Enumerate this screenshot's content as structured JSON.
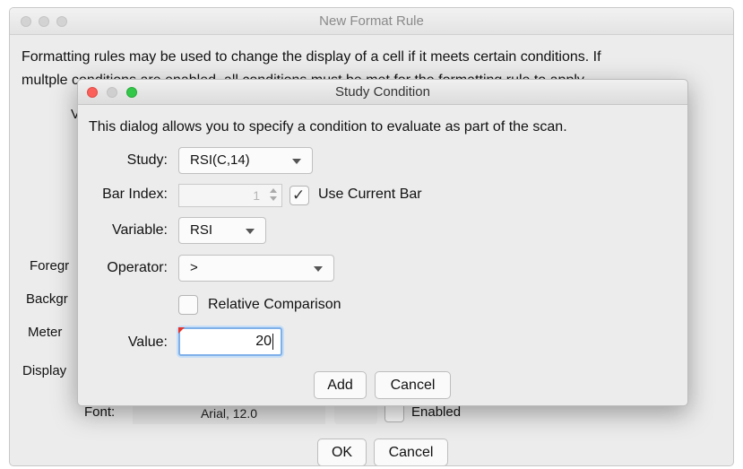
{
  "outer_window": {
    "title": "New Format Rule",
    "description_line1": "Formatting rules may be used to change the display of a cell if it meets certain conditions.  If",
    "description_line2": "multple conditions are enabled, all conditions must be met for the formatting rule to apply.",
    "clipped_labels": [
      "V",
      "Foregr",
      "Backgr",
      "Meter",
      "Display"
    ],
    "font_label": "Font:",
    "font_value": "Arial, 12.0",
    "enabled_label": "Enabled",
    "ok_label": "OK",
    "cancel_label": "Cancel"
  },
  "dialog": {
    "title": "Study Condition",
    "description": "This dialog allows you to specify a condition to evaluate as part of the scan.",
    "study_label": "Study:",
    "study_value": "RSI(C,14)",
    "bar_index_label": "Bar Index:",
    "bar_index_value": "1",
    "use_current_bar_label": "Use Current Bar",
    "use_current_bar_checked": true,
    "variable_label": "Variable:",
    "variable_value": "RSI",
    "operator_label": "Operator:",
    "operator_value": ">",
    "relative_comparison_label": "Relative Comparison",
    "relative_comparison_checked": false,
    "value_label": "Value:",
    "value": "20",
    "add_label": "Add",
    "cancel_label": "Cancel"
  },
  "icons": {
    "checkmark": "checkmark-icon",
    "dropdown": "chevron-down-icon",
    "spinner": "spinner-arrows-icon",
    "pencil": "pencil-icon"
  },
  "colors": {
    "close": "#fc605b",
    "zoom": "#34c84a",
    "focus_ring": "#7fb0e8",
    "error_marker": "#e8332b"
  }
}
